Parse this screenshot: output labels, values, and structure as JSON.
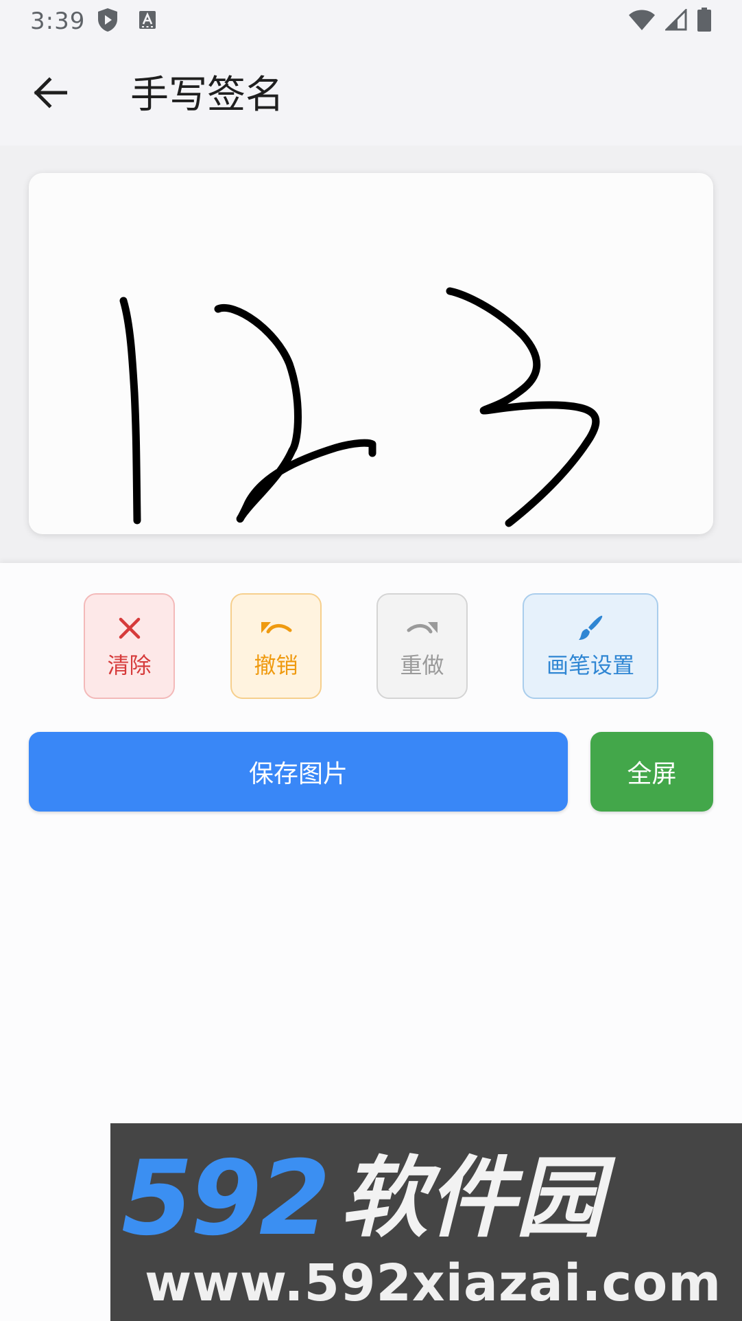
{
  "status_bar": {
    "time": "3:39",
    "left_icons": [
      "shield-play-icon",
      "text-a-icon"
    ],
    "right_icons": [
      "wifi-icon",
      "cell-signal-icon",
      "battery-icon"
    ]
  },
  "app_bar": {
    "back_icon": "arrow-left-icon",
    "title": "手写签名"
  },
  "signature": {
    "ink_color": "#000000"
  },
  "tools": {
    "clear": {
      "label": "清除",
      "icon": "close-icon",
      "color": "#d63b3b"
    },
    "undo": {
      "label": "撤销",
      "icon": "undo-icon",
      "color": "#ef9a10"
    },
    "redo": {
      "label": "重做",
      "icon": "redo-icon",
      "color": "#9a9a9a"
    },
    "brush": {
      "label": "画笔设置",
      "icon": "brush-icon",
      "color": "#2f86d3"
    }
  },
  "actions": {
    "save_label": "保存图片",
    "save_color": "#3987f7",
    "fullscreen_label": "全屏",
    "fullscreen_color": "#43a74a"
  },
  "watermark": {
    "logo_number": "592",
    "logo_text": "软件园",
    "url": "www.592xiazai.com"
  }
}
